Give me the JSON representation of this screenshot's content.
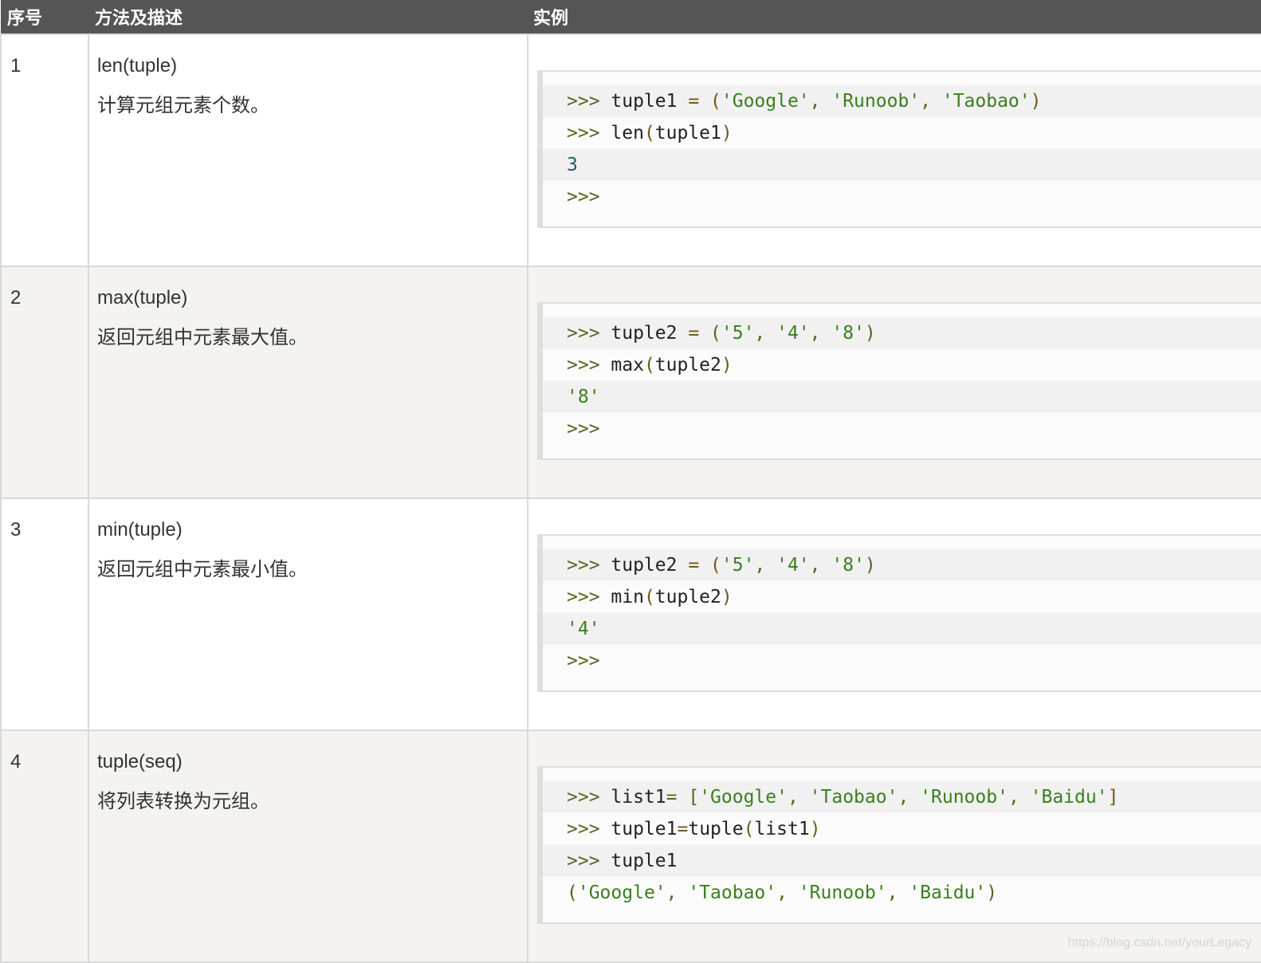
{
  "header": {
    "num": "序号",
    "desc": "方法及描述",
    "example": "实例"
  },
  "rows": [
    {
      "num": "1",
      "method": "len(tuple)",
      "description": "计算元组元素个数。",
      "code": [
        [
          [
            "p",
            ">>> "
          ],
          [
            "k",
            "tuple1 "
          ],
          [
            "o",
            "= ("
          ],
          [
            "s",
            "'Google'"
          ],
          [
            "o",
            ", "
          ],
          [
            "s",
            "'Runoob'"
          ],
          [
            "o",
            ", "
          ],
          [
            "s",
            "'Taobao'"
          ],
          [
            "o",
            ")"
          ]
        ],
        [
          [
            "p",
            ">>> "
          ],
          [
            "k",
            "len"
          ],
          [
            "o",
            "("
          ],
          [
            "k",
            "tuple1"
          ],
          [
            "o",
            ")"
          ]
        ],
        [
          [
            "n",
            "3"
          ]
        ],
        [
          [
            "p",
            ">>>"
          ]
        ]
      ]
    },
    {
      "num": "2",
      "method": "max(tuple)",
      "description": "返回元组中元素最大值。",
      "code": [
        [
          [
            "p",
            ">>> "
          ],
          [
            "k",
            "tuple2 "
          ],
          [
            "o",
            "= ("
          ],
          [
            "s",
            "'5'"
          ],
          [
            "o",
            ", "
          ],
          [
            "s",
            "'4'"
          ],
          [
            "o",
            ", "
          ],
          [
            "s",
            "'8'"
          ],
          [
            "o",
            ")"
          ]
        ],
        [
          [
            "p",
            ">>> "
          ],
          [
            "k",
            "max"
          ],
          [
            "o",
            "("
          ],
          [
            "k",
            "tuple2"
          ],
          [
            "o",
            ")"
          ]
        ],
        [
          [
            "s",
            "'8'"
          ]
        ],
        [
          [
            "p",
            ">>>"
          ]
        ]
      ]
    },
    {
      "num": "3",
      "method": "min(tuple)",
      "description": "返回元组中元素最小值。",
      "code": [
        [
          [
            "p",
            ">>> "
          ],
          [
            "k",
            "tuple2 "
          ],
          [
            "o",
            "= ("
          ],
          [
            "s",
            "'5'"
          ],
          [
            "o",
            ", "
          ],
          [
            "s",
            "'4'"
          ],
          [
            "o",
            ", "
          ],
          [
            "s",
            "'8'"
          ],
          [
            "o",
            ")"
          ]
        ],
        [
          [
            "p",
            ">>> "
          ],
          [
            "k",
            "min"
          ],
          [
            "o",
            "("
          ],
          [
            "k",
            "tuple2"
          ],
          [
            "o",
            ")"
          ]
        ],
        [
          [
            "s",
            "'4'"
          ]
        ],
        [
          [
            "p",
            ">>>"
          ]
        ]
      ]
    },
    {
      "num": "4",
      "method": "tuple(seq)",
      "description": "将列表转换为元组。",
      "code": [
        [
          [
            "p",
            ">>> "
          ],
          [
            "k",
            "list1"
          ],
          [
            "o",
            "= ["
          ],
          [
            "s",
            "'Google'"
          ],
          [
            "o",
            ", "
          ],
          [
            "s",
            "'Taobao'"
          ],
          [
            "o",
            ", "
          ],
          [
            "s",
            "'Runoob'"
          ],
          [
            "o",
            ", "
          ],
          [
            "s",
            "'Baidu'"
          ],
          [
            "o",
            "]"
          ]
        ],
        [
          [
            "p",
            ">>> "
          ],
          [
            "k",
            "tuple1"
          ],
          [
            "o",
            "="
          ],
          [
            "k",
            "tuple"
          ],
          [
            "o",
            "("
          ],
          [
            "k",
            "list1"
          ],
          [
            "o",
            ")"
          ]
        ],
        [
          [
            "p",
            ">>> "
          ],
          [
            "k",
            "tuple1"
          ]
        ],
        [
          [
            "o",
            "("
          ],
          [
            "s",
            "'Google'"
          ],
          [
            "o",
            ", "
          ],
          [
            "s",
            "'Taobao'"
          ],
          [
            "o",
            ", "
          ],
          [
            "s",
            "'Runoob'"
          ],
          [
            "o",
            ", "
          ],
          [
            "s",
            "'Baidu'"
          ],
          [
            "o",
            ")"
          ]
        ]
      ]
    }
  ],
  "watermark": "https://blog.csdn.net/yourLegacy"
}
